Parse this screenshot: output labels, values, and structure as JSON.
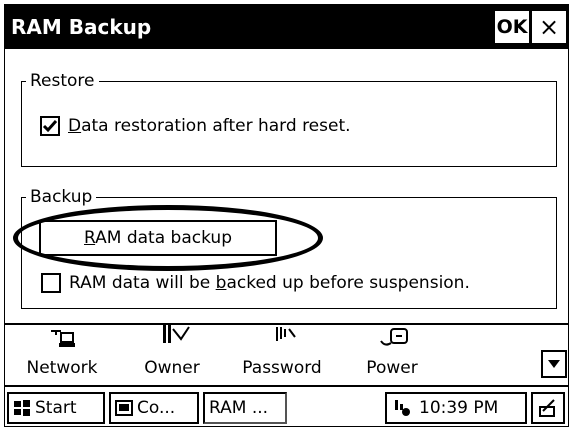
{
  "dialog": {
    "title": "RAM Backup",
    "ok_label": "OK",
    "close_label": "×"
  },
  "restore": {
    "group_label": "Restore",
    "checkbox": {
      "checked": true,
      "access_key": "D",
      "label_rest": "ata restoration after hard reset."
    }
  },
  "backup": {
    "group_label": "Backup",
    "button": {
      "access_key": "R",
      "label_rest": "AM data backup"
    },
    "checkbox": {
      "checked": false,
      "label_before": "RAM data will be ",
      "access_key": "b",
      "label_after": "acked up before suspension."
    }
  },
  "control_panel": {
    "items": [
      {
        "label": "Network",
        "icon": "network-icon"
      },
      {
        "label": "Owner",
        "icon": "owner-icon"
      },
      {
        "label": "Password",
        "icon": "password-icon"
      },
      {
        "label": "Power",
        "icon": "power-icon"
      }
    ],
    "scroll_icon": "scroll-down-icon"
  },
  "taskbar": {
    "start_label": "Start",
    "tasks": [
      {
        "label": "Co...",
        "icon": "control-panel-icon"
      },
      {
        "label": "RAM ...",
        "icon": ""
      }
    ],
    "clock": "10:39 PM",
    "tray_icon": "network-tray-icon",
    "keyboard_icon": "input-panel-icon"
  }
}
